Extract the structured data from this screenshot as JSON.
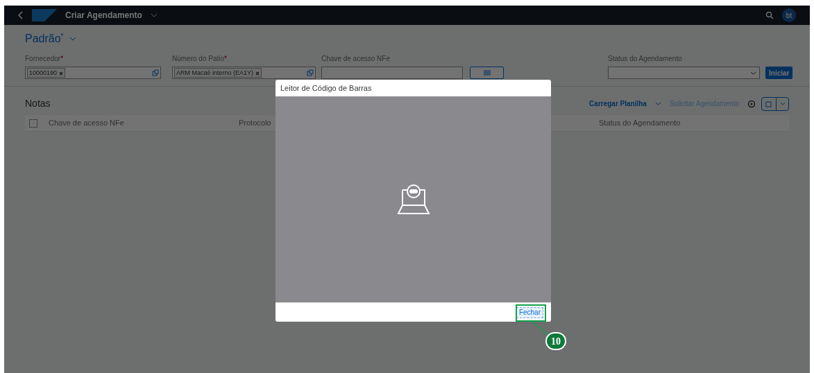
{
  "shell_bar": {
    "title": "Criar Agendamento",
    "avatar": "bt"
  },
  "variant": {
    "name": "Padrão",
    "modified_mark": "*"
  },
  "filters": [
    {
      "kind": "tokens",
      "label": "Fornecedor",
      "required_mark": "*",
      "tokens": [
        "10000190"
      ]
    },
    {
      "kind": "tokens",
      "label": "Número do Patio",
      "required_mark": "*",
      "tokens": [
        "ARM Macaé interno (EA1Y)"
      ]
    },
    {
      "kind": "scan",
      "label": "Chave de acesso NFe"
    },
    {
      "kind": "select",
      "label": "Status do Agendamento"
    }
  ],
  "go_button": "Iniciar",
  "table": {
    "title": "Notas",
    "actions": [
      {
        "label": "Carregar Planilha",
        "disabled": false,
        "menu": true
      },
      {
        "label": "Solicitar Agendamento",
        "disabled": true,
        "menu": false
      }
    ],
    "select_all_checked": false,
    "columns": [
      "Chave de acesso NFe",
      "Protocolo",
      "Status do Agendamento"
    ]
  },
  "dialog": {
    "title": "Leitor de Código de Barras",
    "close_button": "Fechar"
  },
  "callout": {
    "number": "10"
  }
}
